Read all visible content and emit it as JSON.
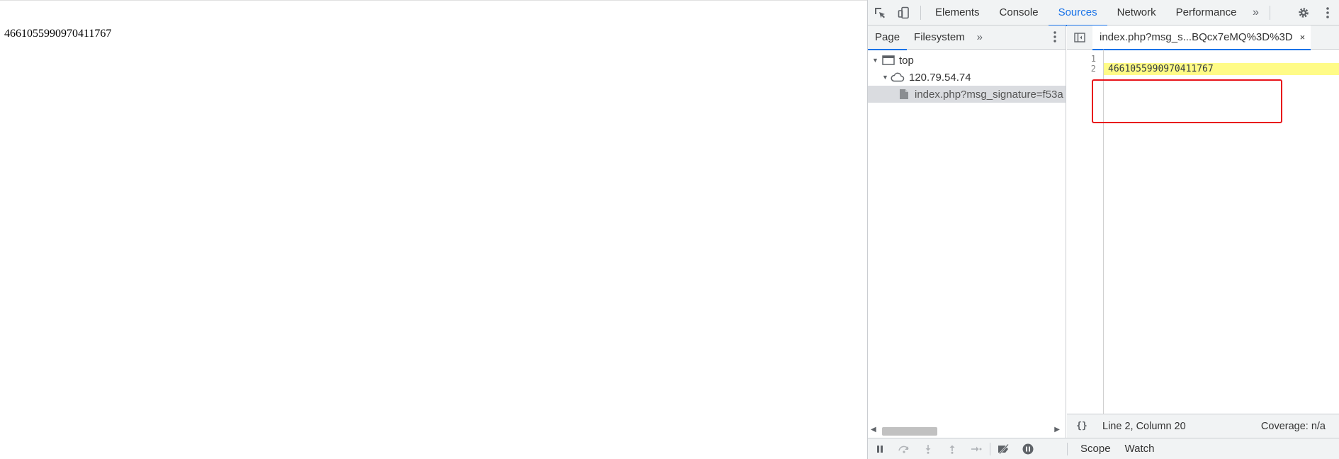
{
  "page": {
    "body_text": "4661055990970411767"
  },
  "devtools": {
    "toolbar": {
      "tabs": [
        {
          "label": "Elements",
          "active": false
        },
        {
          "label": "Console",
          "active": false
        },
        {
          "label": "Sources",
          "active": true
        },
        {
          "label": "Network",
          "active": false
        },
        {
          "label": "Performance",
          "active": false
        }
      ],
      "more": "»"
    },
    "navigator": {
      "tabs": [
        {
          "label": "Page",
          "active": true
        },
        {
          "label": "Filesystem",
          "active": false
        }
      ],
      "more": "»",
      "tree": [
        {
          "label": "top",
          "icon": "frame-icon"
        },
        {
          "label": "120.79.54.74",
          "icon": "cloud-icon"
        },
        {
          "label": "index.php?msg_signature=f53a",
          "icon": "file-icon",
          "selected": true
        }
      ]
    },
    "editor": {
      "open_file_tab": "index.php?msg_s...BQcx7eMQ%3D%3D",
      "close_glyph": "×",
      "line_numbers": [
        "1",
        "2"
      ],
      "lines": [
        "",
        "4661055990970411767"
      ],
      "highlighted_line": 2,
      "status": {
        "pretty_print": "{}",
        "cursor": "Line 2, Column 20",
        "coverage": "Coverage: n/a"
      }
    },
    "debugger": {
      "tabs": [
        "Scope",
        "Watch"
      ]
    },
    "colors": {
      "accent": "#1a73e8",
      "highlight": "#fffb87",
      "annotation": "#e8141a"
    }
  }
}
